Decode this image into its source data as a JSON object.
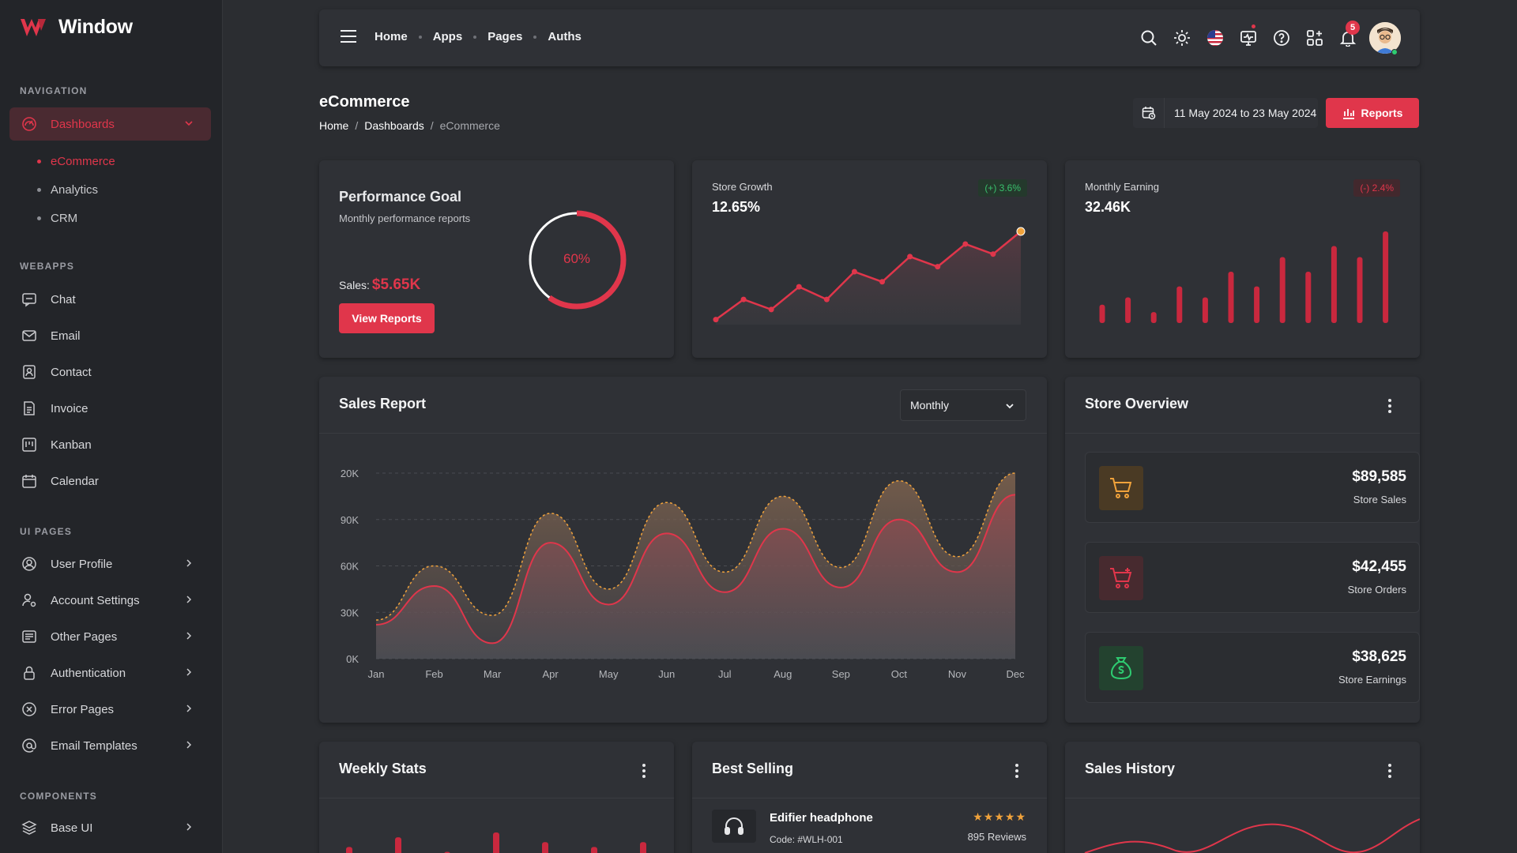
{
  "brand": {
    "name": "Window"
  },
  "sidebar": {
    "headings": {
      "navigation": "NAVIGATION",
      "webapps": "WEBAPPS",
      "ui_pages": "UI PAGES",
      "components": "COMPONENTS"
    },
    "dashboards": {
      "label": "Dashboards",
      "children": [
        "eCommerce",
        "Analytics",
        "CRM"
      ]
    },
    "webapps": [
      "Chat",
      "Email",
      "Contact",
      "Invoice",
      "Kanban",
      "Calendar"
    ],
    "ui_pages": [
      "User Profile",
      "Account Settings",
      "Other Pages",
      "Authentication",
      "Error Pages",
      "Email Templates"
    ],
    "components": [
      "Base UI"
    ]
  },
  "topbar": {
    "nav": [
      "Home",
      "Apps",
      "Pages",
      "Auths"
    ],
    "notification_count": "5"
  },
  "page": {
    "title": "eCommerce",
    "breadcrumb": [
      "Home",
      "Dashboards",
      "eCommerce"
    ],
    "date_range": "11 May 2024 to 23 May 2024",
    "reports_label": "Reports"
  },
  "performance": {
    "title": "Performance Goal",
    "subtitle": "Monthly performance reports",
    "sales_label": "Sales:",
    "sales_value": "$5.65K",
    "button": "View Reports",
    "percent_label": "60%",
    "percent": 60
  },
  "store_growth": {
    "label": "Store Growth",
    "value": "12.65%",
    "badge": "(+) 3.6%"
  },
  "monthly_earning": {
    "label": "Monthly Earning",
    "value": "32.46K",
    "badge": "(-) 2.4%"
  },
  "sales_report": {
    "title": "Sales Report",
    "period": "Monthly"
  },
  "store_overview": {
    "title": "Store Overview",
    "items": [
      {
        "value": "$89,585",
        "label": "Store Sales",
        "icon": "cart-icon",
        "bg": "#4a3a24",
        "fg": "#f0a23b"
      },
      {
        "value": "$42,455",
        "label": "Store Orders",
        "icon": "cart-plus-icon",
        "bg": "#472a2f",
        "fg": "#e0364b"
      },
      {
        "value": "$38,625",
        "label": "Store Earnings",
        "icon": "money-bag-icon",
        "bg": "#23422f",
        "fg": "#2ecc71"
      }
    ]
  },
  "weekly_stats": {
    "title": "Weekly Stats"
  },
  "best_selling": {
    "title": "Best Selling",
    "items": [
      {
        "name": "Edifier headphone",
        "code": "Code: #WLH-001",
        "stars": "★★★★★",
        "reviews": "895 Reviews"
      }
    ]
  },
  "sales_history": {
    "title": "Sales History"
  },
  "colors": {
    "accent": "#e0364b",
    "card": "#2f3136",
    "background": "#2b2d31",
    "sidebar": "#232529"
  },
  "chart_data": [
    {
      "type": "line",
      "id": "store-growth",
      "x": [
        1,
        2,
        3,
        4,
        5,
        6,
        7,
        8,
        9,
        10,
        11,
        12
      ],
      "values": [
        2,
        10,
        6,
        15,
        10,
        21,
        17,
        27,
        23,
        32,
        28,
        37
      ]
    },
    {
      "type": "bar",
      "id": "monthly-earning",
      "values": [
        2.5,
        3.5,
        1.5,
        5,
        3.5,
        7,
        5,
        9,
        7,
        10.5,
        9,
        12.5
      ]
    },
    {
      "type": "area",
      "id": "sales-report",
      "categories": [
        "Jan",
        "Feb",
        "Mar",
        "Apr",
        "May",
        "Jun",
        "Jul",
        "Aug",
        "Sep",
        "Oct",
        "Nov",
        "Dec"
      ],
      "y_ticks": [
        "0K",
        "30K",
        "60K",
        "90K",
        "20K"
      ],
      "series": [
        {
          "values": [
            22,
            47,
            10,
            75,
            35,
            81,
            43,
            84,
            46,
            90,
            56,
            106
          ]
        },
        {
          "values": [
            25,
            60,
            28,
            94,
            45,
            101,
            56,
            105,
            59,
            115,
            66,
            120
          ]
        }
      ],
      "ylim": [
        0,
        120
      ]
    },
    {
      "type": "bar",
      "id": "weekly-stats",
      "values": [
        6,
        8,
        5,
        9,
        7,
        6,
        7
      ]
    }
  ]
}
